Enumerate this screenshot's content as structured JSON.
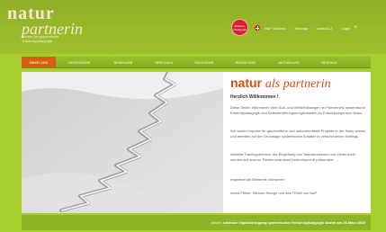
{
  "brand": {
    "word1": "natur",
    "word2": "partnerin",
    "tagline": "Verein für systemische Erlebnispädagogik"
  },
  "topnav": {
    "badge": "Erlebnis-Pädagogik",
    "links": [
      "NaP Schweiz",
      "Sitemap",
      "Index A-Z",
      "Login"
    ],
    "plus": "+"
  },
  "menu": [
    {
      "label": "Über uns",
      "active": true
    },
    {
      "label": "Lehrgänge",
      "active": false
    },
    {
      "label": "Seminare",
      "active": false
    },
    {
      "label": "Specials",
      "active": false
    },
    {
      "label": "Fachtage",
      "active": false
    },
    {
      "label": "Beratung",
      "active": false
    },
    {
      "label": "Aktuelles",
      "active": false
    },
    {
      "label": "Service",
      "active": false
    }
  ],
  "content": {
    "title_strong": "natur",
    "title_italic": "als partnerin",
    "greeting": "Herzlich Willkommen !",
    "p1": "Diese Seiten informieren über Aus- und Weiterbildungen im Partnernetz systemische Erlebnispädagogik und Selbsterfahrungsmöglichkeiten im Entwicklungsraum Natur.",
    "p2": "Wir wollen Impulse für ganzheitliche und naturorientierte Projekte in der Natur setzen und arbeiten auf der Grundlage systemischer Ansätze in verschiedenen Settings.",
    "p3": "Aktuelle Trainingstermine, die Begleitung von Teamprozessen und Vieles mehr werden auf unserer Partnerseite www.Lindenhaum.at präsentiert.",
    "p4": "Inspirierende Momente wünschen",
    "p5": "Astrid Pöltler, Michael Stange und das TEAM von NaP"
  },
  "footer": {
    "lead": "aktuell:",
    "text": "nächster Diplomlehrgang systemischer Erlebnispädagogik startet am 26.März 2015"
  }
}
